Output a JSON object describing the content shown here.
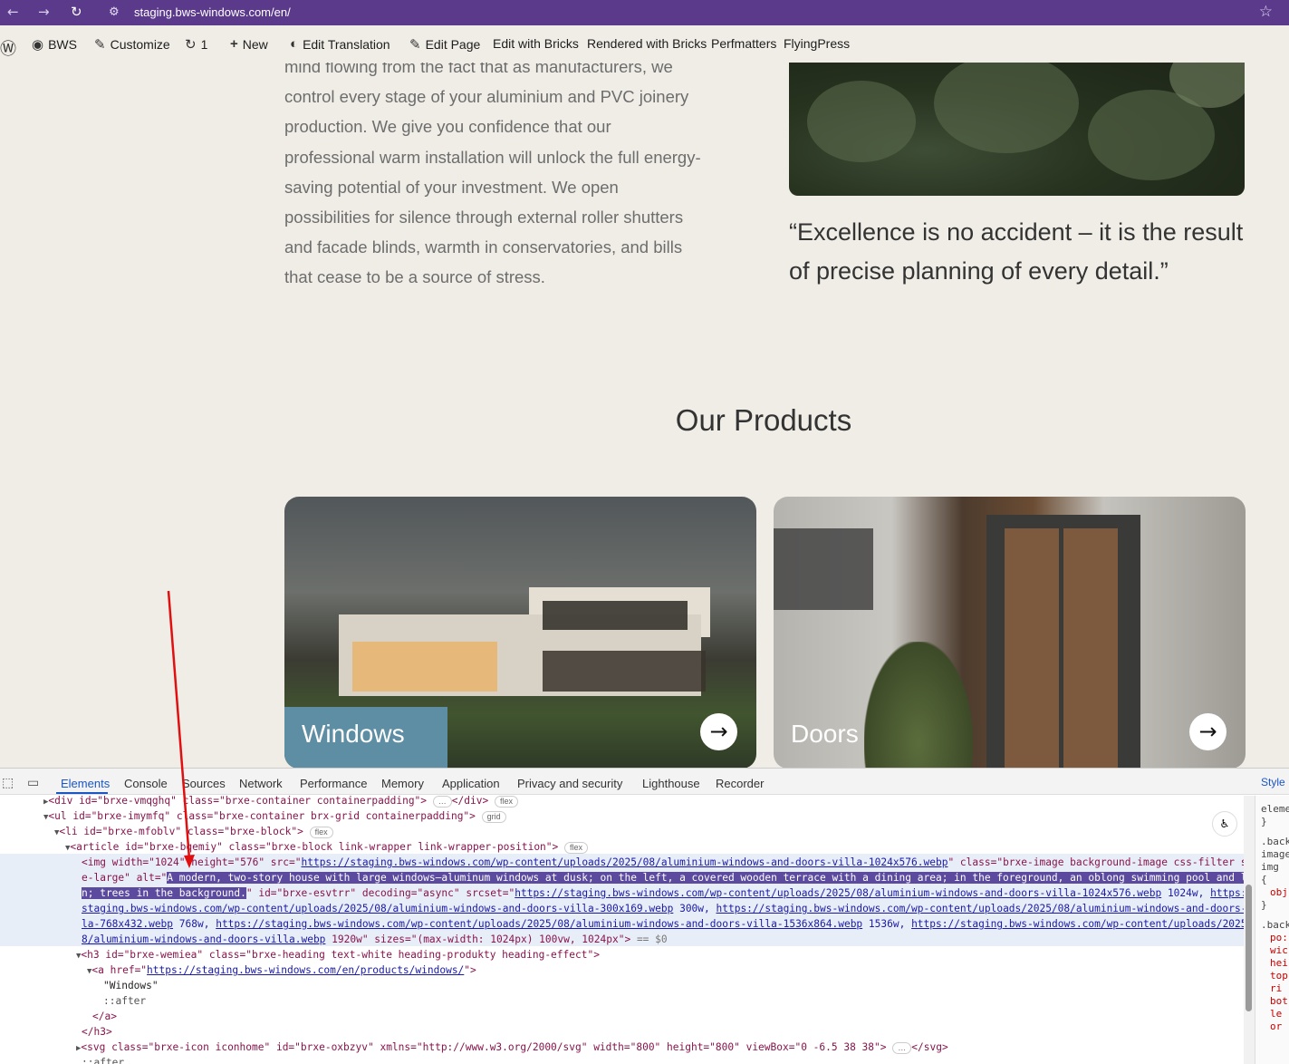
{
  "browser": {
    "back_icon": "←",
    "forward_icon": "→",
    "reload_icon": "↻",
    "site_info_icon": "⚙",
    "url": "staging.bws-windows.com/en/",
    "bookmark_icon": "☆"
  },
  "adminbar": {
    "items": [
      {
        "icon": "Ⓦ",
        "label": ""
      },
      {
        "icon": "◉",
        "label": "BWS"
      },
      {
        "icon": "✎",
        "label": "Customize"
      },
      {
        "icon": "↻",
        "label": "1"
      },
      {
        "icon": "+",
        "label": "New"
      },
      {
        "icon": "◐",
        "label": "Edit Translation"
      },
      {
        "icon": "✎",
        "label": "Edit Page"
      },
      {
        "icon": "",
        "label": "Edit with Bricks"
      },
      {
        "icon": "",
        "label": "Rendered with Bricks"
      },
      {
        "icon": "",
        "label": "Perfmatters"
      },
      {
        "icon": "",
        "label": "FlyingPress"
      }
    ]
  },
  "page": {
    "intro_lines": [
      "mind flowing from the fact that as manufacturers, we",
      "control every stage of your aluminium and PVC joinery",
      "production. We give you confidence that our",
      "professional warm installation will unlock the full energy-",
      "saving potential of your investment. We open",
      "possibilities for silence through external roller shutters",
      "and facade blinds, warmth in conservatories, and bills",
      "that cease to be a source of stress."
    ],
    "quote": "“Excellence is no accident – it is the result of precise planning of every detail.”",
    "section_title": "Our Products",
    "products": [
      {
        "label": "Windows",
        "arrow": "→"
      },
      {
        "label": "Doors",
        "arrow": "→"
      }
    ]
  },
  "devtools": {
    "tabs": [
      "Elements",
      "Console",
      "Sources",
      "Network",
      "Performance",
      "Memory",
      "Application",
      "Privacy and security",
      "Lighthouse",
      "Recorder"
    ],
    "inspect_icon": "⬚",
    "device_icon": "▭",
    "styles_tab": "Style",
    "accessibility_icon": "♿",
    "dom": {
      "l0_open": "<div id=\"brxe-vmqghq\" class=\"brxe-container containerpadding\">",
      "l0_ellipsis": "…",
      "l0_close": "</div>",
      "chip_flex": "flex",
      "chip_grid": "grid",
      "l1": "<ul id=\"brxe-imymfq\" class=\"brxe-container brx-grid containerpadding\">",
      "l2": "<li id=\"brxe-mfoblv\" class=\"brxe-block\">",
      "l3": "<article id=\"brxe-bqemiy\" class=\"brxe-block link-wrapper link-wrapper-position\">",
      "img_a": "<img width=\"1024\" height=\"576\" src=\"",
      "img_src": "https://staging.bws-windows.com/wp-content/uploads/2025/08/aluminium-windows-and-doors-villa-1024x576.webp",
      "img_b": "\" class=\"brxe-image background-image css-filter siz",
      "img_c": "e-large\" alt=\"",
      "alt_1": "A modern, two-story house with large windows—aluminum windows at dusk; on the left, a covered wooden terrace with a dining area; in the foreground, an oblong swimming pool and law",
      "alt_2": "n; trees in the background.",
      "img_d": "\" id=\"brxe-esvtrr\" decoding=\"async\" srcset=\"",
      "srcset_1": "https://staging.bws-windows.com/wp-content/uploads/2025/08/aluminium-windows-and-doors-villa-1024x576.webp",
      "srcset_1w": " 1024w, ",
      "srcset_2a": "https://",
      "srcset_2b": "staging.bws-windows.com/wp-content/uploads/2025/08/aluminium-windows-and-doors-villa-300x169.webp",
      "srcset_2w": " 300w, ",
      "srcset_3a": "https://staging.bws-windows.com/wp-content/uploads/2025/08/aluminium-windows-and-doors-vil",
      "srcset_3b": "la-768x432.webp",
      "srcset_3w": " 768w, ",
      "srcset_4": "https://staging.bws-windows.com/wp-content/uploads/2025/08/aluminium-windows-and-doors-villa-1536x864.webp",
      "srcset_4w": " 1536w, ",
      "srcset_5a": "https://staging.bws-windows.com/wp-content/uploads/2025/0",
      "srcset_5b": "8/aluminium-windows-and-doors-villa.webp",
      "srcset_5w": " 1920w\" sizes=\"(max-width: 1024px) 100vw, 1024px\">",
      "eq_sel": " == $0",
      "h3": "<h3 id=\"brxe-wemiea\" class=\"brxe-heading text-white heading-produkty heading-effect\">",
      "a_open": "<a href=\"",
      "a_href": "https://staging.bws-windows.com/en/products/windows/",
      "a_close_bracket": "\">",
      "text_windows": "\"Windows\"",
      "after": "::after",
      "a_close": "</a>",
      "h3_close": "</h3>",
      "svg_line": "<svg class=\"brxe-icon iconhome\" id=\"brxe-oxbzyv\" xmlns=\"http://www.w3.org/2000/svg\" width=\"800\" height=\"800\" viewBox=\"0 -6.5 38 38\">",
      "svg_close": "</svg>",
      "after2": "::after"
    },
    "styles_lines": [
      "eleme",
      "}",
      ".back",
      "image",
      "img {",
      "obj",
      "}",
      ".back",
      "po:",
      "wic",
      "hei",
      "top",
      "ri",
      "bot",
      "le",
      "or"
    ]
  },
  "colors": {
    "chrome_bg": "#5b3a8c",
    "page_bg": "#f0ede6",
    "selection_highlight": "#5b4a9e",
    "annotation_arrow": "#e01010"
  }
}
